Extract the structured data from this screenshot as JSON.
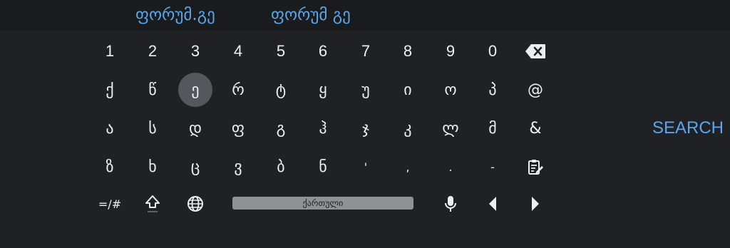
{
  "suggestions": [
    "ფორუმ.გე",
    "ფორუმ გე"
  ],
  "rows": {
    "digits": [
      "1",
      "2",
      "3",
      "4",
      "5",
      "6",
      "7",
      "8",
      "9",
      "0"
    ],
    "row1": [
      "ქ",
      "წ",
      "ე",
      "რ",
      "ტ",
      "ყ",
      "უ",
      "ი",
      "ო",
      "პ",
      "@"
    ],
    "row2": [
      "ა",
      "ს",
      "დ",
      "ფ",
      "გ",
      "ჰ",
      "ჯ",
      "კ",
      "ლ",
      "მ",
      "&"
    ],
    "row3": [
      "ზ",
      "ხ",
      "ც",
      "ვ",
      "ბ",
      "ნ",
      "'",
      ",",
      ".",
      "-"
    ]
  },
  "bottom": {
    "symbols_label": "=/#",
    "space_label": "ქართული"
  },
  "action_label": "SEARCH",
  "focused_key": "ე",
  "colors": {
    "background": "#202124",
    "suggestion_bar": "#1a1b1d",
    "accent": "#5aa6ee",
    "key_text": "#eceff1",
    "focus_ring": "#54575c",
    "spacebar": "#8f9194"
  },
  "icons": {
    "backspace": "backspace-icon",
    "clipboard": "clipboard-edit-icon",
    "shift": "shift-icon",
    "language": "globe-icon",
    "voice": "microphone-icon",
    "cursor_left": "arrow-left-icon",
    "cursor_right": "arrow-right-icon"
  }
}
